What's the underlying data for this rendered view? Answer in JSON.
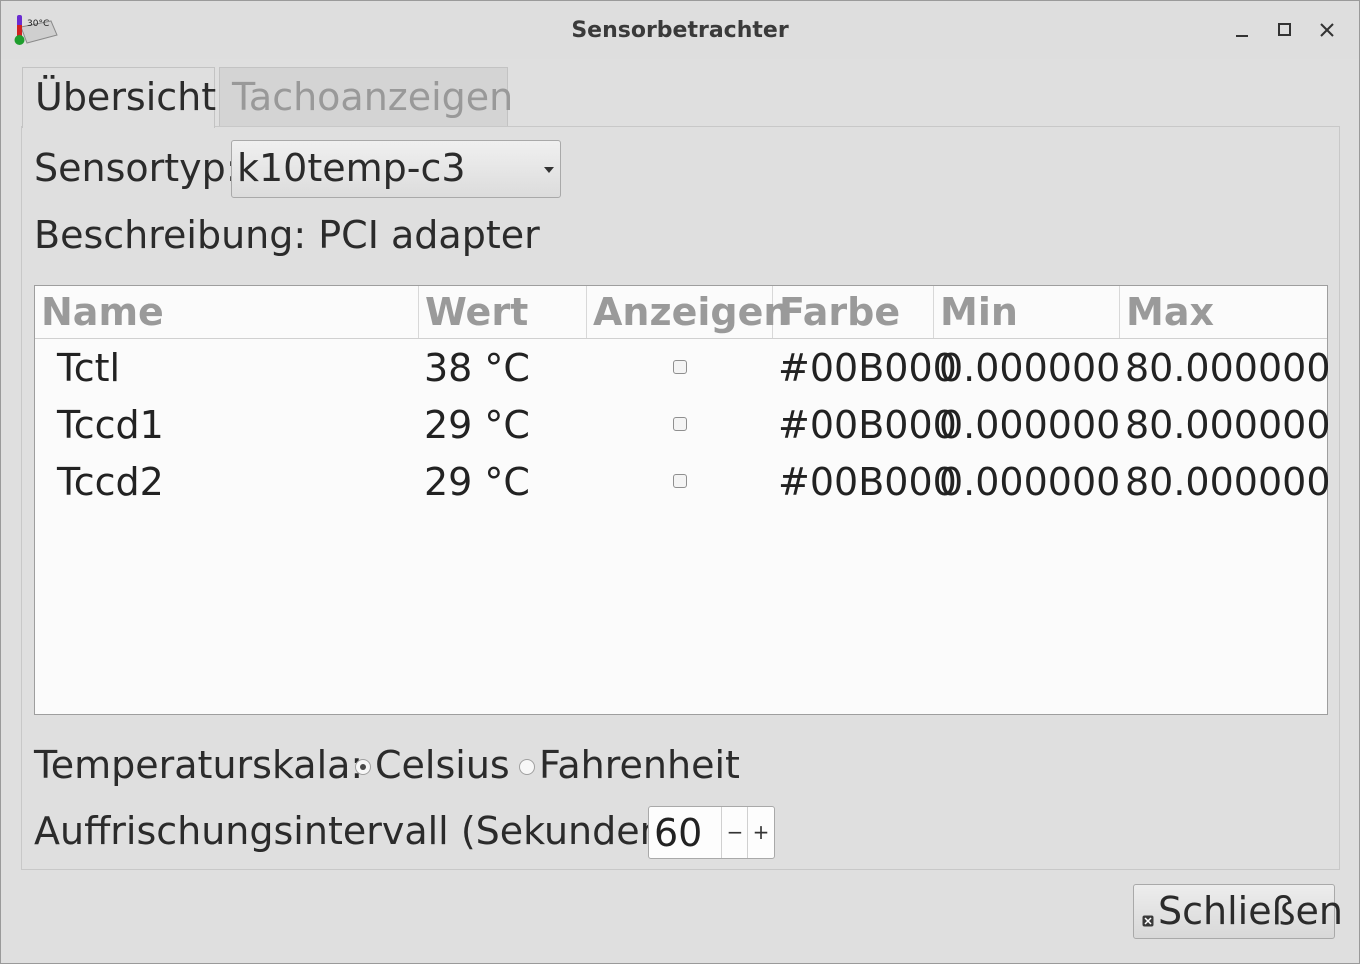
{
  "window": {
    "title": "Sensorbetrachter",
    "icon_text": "30°C"
  },
  "tabs": [
    {
      "label": "Übersicht",
      "active": true
    },
    {
      "label": "Tachoanzeigen",
      "active": false
    }
  ],
  "overview": {
    "sensor_type_label": "Sensortyp:",
    "sensor_type_value": "k10temp-c3",
    "description_label": "Beschreibung:",
    "description_value": "PCI adapter",
    "table": {
      "columns": [
        "Name",
        "Wert",
        "Anzeigen",
        "Farbe",
        "Min",
        "Max"
      ],
      "rows": [
        {
          "name": "Tctl",
          "wert": "38 °C",
          "anzeigen": false,
          "farbe": "#00B000",
          "min": "0.000000",
          "max": "80.000000"
        },
        {
          "name": "Tccd1",
          "wert": "29 °C",
          "anzeigen": false,
          "farbe": "#00B000",
          "min": "0.000000",
          "max": "80.000000"
        },
        {
          "name": "Tccd2",
          "wert": "29 °C",
          "anzeigen": false,
          "farbe": "#00B000",
          "min": "0.000000",
          "max": "80.000000"
        }
      ]
    },
    "temp_scale_label": "Temperaturskala:",
    "temp_scale_options": [
      {
        "label": "Celsius",
        "selected": true
      },
      {
        "label": "Fahrenheit",
        "selected": false
      }
    ],
    "refresh_label": "Auffrischungsintervall (Sekunden):",
    "refresh_value": "60",
    "spin_minus": "−",
    "spin_plus": "+"
  },
  "footer": {
    "close_label": "Schließen"
  },
  "colors": {
    "sensor_color": "#00B000"
  }
}
